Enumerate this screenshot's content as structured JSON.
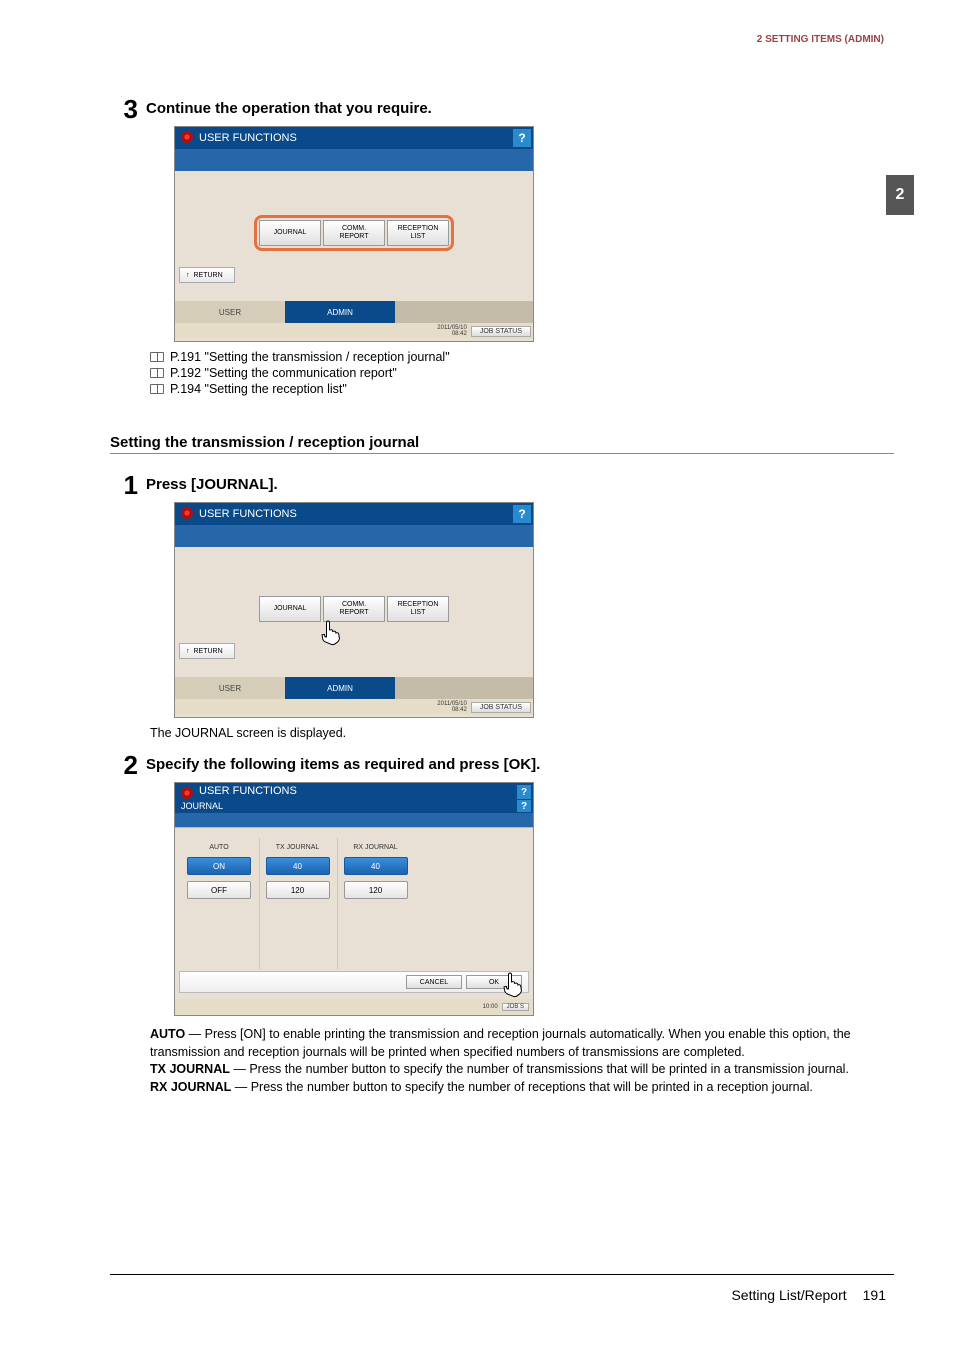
{
  "header": {
    "section": "2 SETTING ITEMS (ADMIN)"
  },
  "side_tab": "2",
  "step3": {
    "num": "3",
    "title": "Continue the operation that you require.",
    "screen": {
      "title": "USER FUNCTIONS",
      "help": "?",
      "buttons": [
        "JOURNAL",
        "COMM.\nREPORT",
        "RECEPTION\nLIST"
      ],
      "return": "RETURN",
      "tabs": [
        "USER",
        "ADMIN"
      ],
      "datetime": "2011/05/10\n08:42",
      "status_btn": "JOB STATUS"
    },
    "refs": [
      "P.191 \"Setting the transmission / reception journal\"",
      "P.192 \"Setting the communication report\"",
      "P.194 \"Setting the reception list\""
    ]
  },
  "section_heading": "Setting the transmission / reception journal",
  "step1": {
    "num": "1",
    "title": "Press [JOURNAL].",
    "screen": {
      "title": "USER FUNCTIONS",
      "help": "?",
      "buttons": [
        "JOURNAL",
        "COMM.\nREPORT",
        "RECEPTION\nLIST"
      ],
      "return": "RETURN",
      "tabs": [
        "USER",
        "ADMIN"
      ],
      "datetime": "2011/05/10\n08:42",
      "status_btn": "JOB STATUS"
    },
    "after_text": "The JOURNAL screen is displayed."
  },
  "step2": {
    "num": "2",
    "title": "Specify the following items as required and press [OK].",
    "screen": {
      "title": "USER FUNCTIONS",
      "subtitle": "JOURNAL",
      "help": "?",
      "columns": [
        {
          "header": "AUTO",
          "options": [
            "ON",
            "OFF"
          ],
          "selected": 0
        },
        {
          "header": "TX JOURNAL",
          "options": [
            "40",
            "120"
          ],
          "selected": 0
        },
        {
          "header": "RX JOURNAL",
          "options": [
            "40",
            "120"
          ],
          "selected": 0
        }
      ],
      "cancel": "CANCEL",
      "ok": "OK",
      "datetime": "10:00",
      "status_btn": "JOB S"
    },
    "definitions": {
      "auto_label": "AUTO",
      "auto_text": " — Press [ON] to enable printing the transmission and reception journals automatically. When you enable this option, the transmission and reception journals will be printed when specified numbers of transmissions are completed.",
      "tx_label": "TX JOURNAL",
      "tx_text": " — Press the number button to specify the number of transmissions that will be printed in a transmission journal.",
      "rx_label": "RX JOURNAL",
      "rx_text": " — Press the number button to specify the number of receptions that will be printed in a reception journal."
    }
  },
  "footer": {
    "title": "Setting List/Report",
    "page": "191"
  }
}
